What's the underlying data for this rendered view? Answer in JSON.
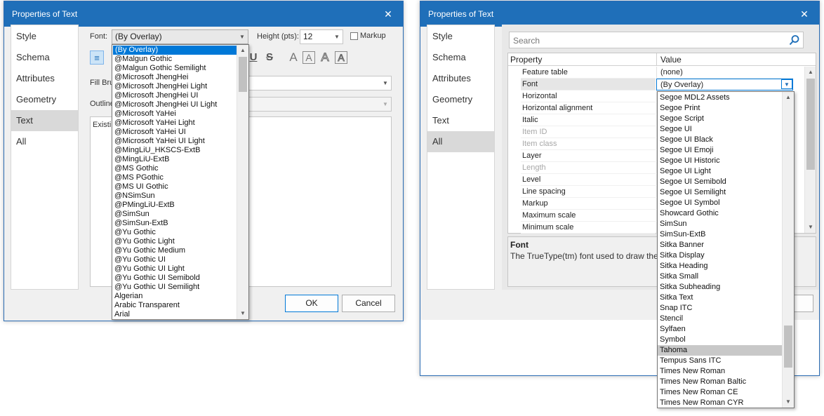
{
  "left_dialog": {
    "title": "Properties of Text",
    "close_glyph": "✕",
    "nav": [
      "Style",
      "Schema",
      "Attributes",
      "Geometry",
      "Text",
      "All"
    ],
    "nav_selected": "Text",
    "font_label": "Font:",
    "font_value": "(By Overlay)",
    "height_label": "Height (pts):",
    "height_value": "12",
    "markup_label": "Markup",
    "fill_brush_label": "Fill Bru",
    "outline_label": "Outline",
    "text_area_value": "Existin",
    "ok_label": "OK",
    "cancel_label": "Cancel",
    "format_buttons": [
      {
        "icon": "align-left-icon",
        "glyph": "≡"
      },
      {
        "icon": "underline-icon",
        "glyph": "U"
      },
      {
        "icon": "strikethrough-icon",
        "glyph": "S"
      },
      {
        "icon": "text-style-plain-icon",
        "glyph": "A"
      },
      {
        "icon": "text-style-boxed-icon",
        "glyph": "A"
      },
      {
        "icon": "text-style-outline-icon",
        "glyph": "A"
      },
      {
        "icon": "text-style-boxed-outline-icon",
        "glyph": "A"
      }
    ],
    "font_dropdown": [
      "(By Overlay)",
      "@Malgun Gothic",
      "@Malgun Gothic Semilight",
      "@Microsoft JhengHei",
      "@Microsoft JhengHei Light",
      "@Microsoft JhengHei UI",
      "@Microsoft JhengHei UI Light",
      "@Microsoft YaHei",
      "@Microsoft YaHei Light",
      "@Microsoft YaHei UI",
      "@Microsoft YaHei UI Light",
      "@MingLiU_HKSCS-ExtB",
      "@MingLiU-ExtB",
      "@MS Gothic",
      "@MS PGothic",
      "@MS UI Gothic",
      "@NSimSun",
      "@PMingLiU-ExtB",
      "@SimSun",
      "@SimSun-ExtB",
      "@Yu Gothic",
      "@Yu Gothic Light",
      "@Yu Gothic Medium",
      "@Yu Gothic UI",
      "@Yu Gothic UI Light",
      "@Yu Gothic UI Semibold",
      "@Yu Gothic UI Semilight",
      "Algerian",
      "Arabic Transparent",
      "Arial"
    ],
    "font_dropdown_selected": "(By Overlay)"
  },
  "right_dialog": {
    "title": "Properties of Text",
    "close_glyph": "✕",
    "nav": [
      "Style",
      "Schema",
      "Attributes",
      "Geometry",
      "Text",
      "All"
    ],
    "nav_selected": "All",
    "search_placeholder": "Search",
    "col_property": "Property",
    "col_value": "Value",
    "properties": [
      {
        "name": "Feature table",
        "value": "(none)",
        "disabled": false
      },
      {
        "name": "Font",
        "value": "(By Overlay)",
        "disabled": false
      },
      {
        "name": "Horizontal",
        "value": "",
        "disabled": false
      },
      {
        "name": "Horizontal alignment",
        "value": "",
        "disabled": false
      },
      {
        "name": "Italic",
        "value": "",
        "disabled": false
      },
      {
        "name": "Item ID",
        "value": "",
        "disabled": true
      },
      {
        "name": "Item class",
        "value": "",
        "disabled": true
      },
      {
        "name": "Layer",
        "value": "",
        "disabled": false
      },
      {
        "name": "Length",
        "value": "",
        "disabled": true
      },
      {
        "name": "Level",
        "value": "",
        "disabled": false
      },
      {
        "name": "Line spacing",
        "value": "",
        "disabled": false
      },
      {
        "name": "Markup",
        "value": "",
        "disabled": false
      },
      {
        "name": "Maximum scale",
        "value": "",
        "disabled": false
      },
      {
        "name": "Minimum scale",
        "value": "",
        "disabled": false
      }
    ],
    "description_title": "Font",
    "description_text": "The TrueType(tm) font used to draw the text",
    "font_dropdown": [
      "Segoe MDL2 Assets",
      "Segoe Print",
      "Segoe Script",
      "Segoe UI",
      "Segoe UI Black",
      "Segoe UI Emoji",
      "Segoe UI Historic",
      "Segoe UI Light",
      "Segoe UI Semibold",
      "Segoe UI Semilight",
      "Segoe UI Symbol",
      "Showcard Gothic",
      "SimSun",
      "SimSun-ExtB",
      "Sitka Banner",
      "Sitka Display",
      "Sitka Heading",
      "Sitka Small",
      "Sitka Subheading",
      "Sitka Text",
      "Snap ITC",
      "Stencil",
      "Sylfaen",
      "Symbol",
      "Tahoma",
      "Tempus Sans ITC",
      "Times New Roman",
      "Times New Roman Baltic",
      "Times New Roman CE",
      "Times New Roman CYR"
    ],
    "font_dropdown_hover": "Tahoma"
  },
  "colors": {
    "titlebar": "#1f6fb9",
    "selection": "#0078d7",
    "hover": "#c8c8c8",
    "nav_selected": "#d9d9d9"
  }
}
